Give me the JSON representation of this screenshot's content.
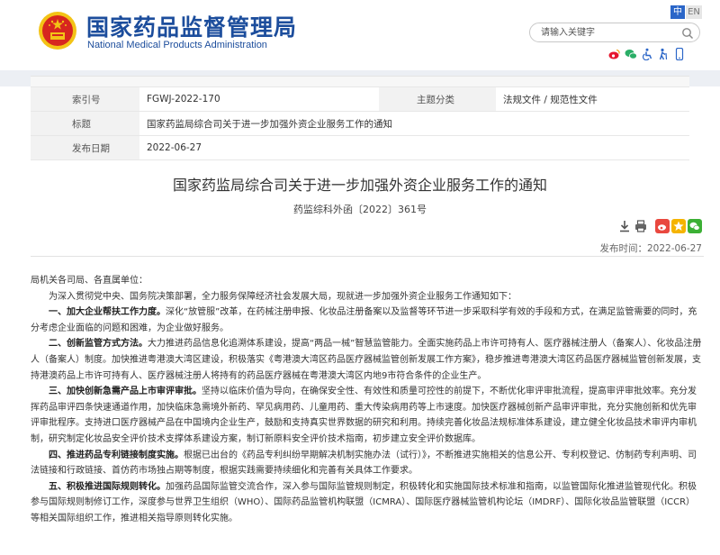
{
  "site": {
    "name_cn": "国家药品监督管理局",
    "name_en": "National Medical Products Administration",
    "lang_zh": "中",
    "lang_en": "EN"
  },
  "search": {
    "placeholder": "请输入关键字"
  },
  "quick_links": [
    "weibo-icon",
    "wechat-icon",
    "accessibility-icon",
    "elder-mode-icon",
    "mobile-icon"
  ],
  "meta": {
    "index_label": "索引号",
    "index_value": "FGWJ-2022-170",
    "category_label": "主题分类",
    "category_value": "法规文件 / 规范性文件",
    "title_label": "标题",
    "title_value": "国家药监局综合司关于进一步加强外资企业服务工作的通知",
    "date_label": "发布日期",
    "date_value": "2022-06-27"
  },
  "doc": {
    "title": "国家药监局综合司关于进一步加强外资企业服务工作的通知",
    "number": "药监综科外函〔2022〕361号",
    "pubdate": "发布时间：2022-06-27"
  },
  "body": {
    "salutation": "局机关各司局、各直属单位：",
    "intro": "为深入贯彻党中央、国务院决策部署，全力服务保障经济社会发展大局，现就进一步加强外资企业服务工作通知如下：",
    "s1_head": "一、加大企业帮扶工作力度。",
    "s1_text": "深化“放管服”改革，在药械注册申报、化妆品注册备案以及监督等环节进一步采取科学有效的手段和方式，在满足监管需要的同时，充分考虑企业面临的问题和困难，为企业做好服务。",
    "s2_head": "二、创新监管方式方法。",
    "s2_text": "大力推进药品信息化追溯体系建设，提高“两品一械”智慧监管能力。全面实施药品上市许可持有人、医疗器械注册人（备案人）、化妆品注册人（备案人）制度。加快推进粤港澳大湾区建设，积极落实《粤港澳大湾区药品医疗器械监管创新发展工作方案》，稳步推进粤港澳大湾区药品医疗器械监管创新发展，支持港澳药品上市许可持有人、医疗器械注册人将持有的药品医疗器械在粤港澳大湾区内地9市符合条件的企业生产。",
    "s3_head": "三、加快创新急需产品上市审评审批。",
    "s3_text": "坚持以临床价值为导向，在确保安全性、有效性和质量可控性的前提下，不断优化审评审批流程，提高审评审批效率。充分发挥药品审评四条快速通道作用，加快临床急需境外新药、罕见病用药、儿童用药、重大传染病用药等上市速度。加快医疗器械创新产品审评审批，充分实施创新和优先审评审批程序。支持进口医疗器械产品在中国境内企业生产，鼓励和支持真实世界数据的研究和利用。持续完善化妆品法规标准体系建设，建立健全化妆品技术审评内审机制，研究制定化妆品安全评价技术支撑体系建设方案，制订新原料安全评价技术指南，初步建立安全评价数据库。",
    "s4_head": "四、推进药品专利链接制度实施。",
    "s4_text": "根据已出台的《药品专利纠纷早期解决机制实施办法（试行）》，不断推进实施相关的信息公开、专利权登记、仿制药专利声明、司法链接和行政链接、首仿药市场独占期等制度，根据实践需要持续细化和完善有关具体工作要求。",
    "s5_head": "五、积极推进国际规则转化。",
    "s5_text": "加强药品国际监管交流合作，深入参与国际监管规则制定，积极转化和实施国际技术标准和指南，以监管国际化推进监管现代化。积极参与国际规则制修订工作，深度参与世界卫生组织（WHO）、国际药品监管机构联盟（ICMRA）、国际医疗器械监管机构论坛（IMDRF）、国际化妆品监管联盟（ICCR）等相关国际组织工作，推进相关指导原则转化实施。"
  },
  "colors": {
    "brand_blue": "#1c4d9c",
    "emblem_red": "#d7261f",
    "emblem_gold": "#f3c316"
  }
}
